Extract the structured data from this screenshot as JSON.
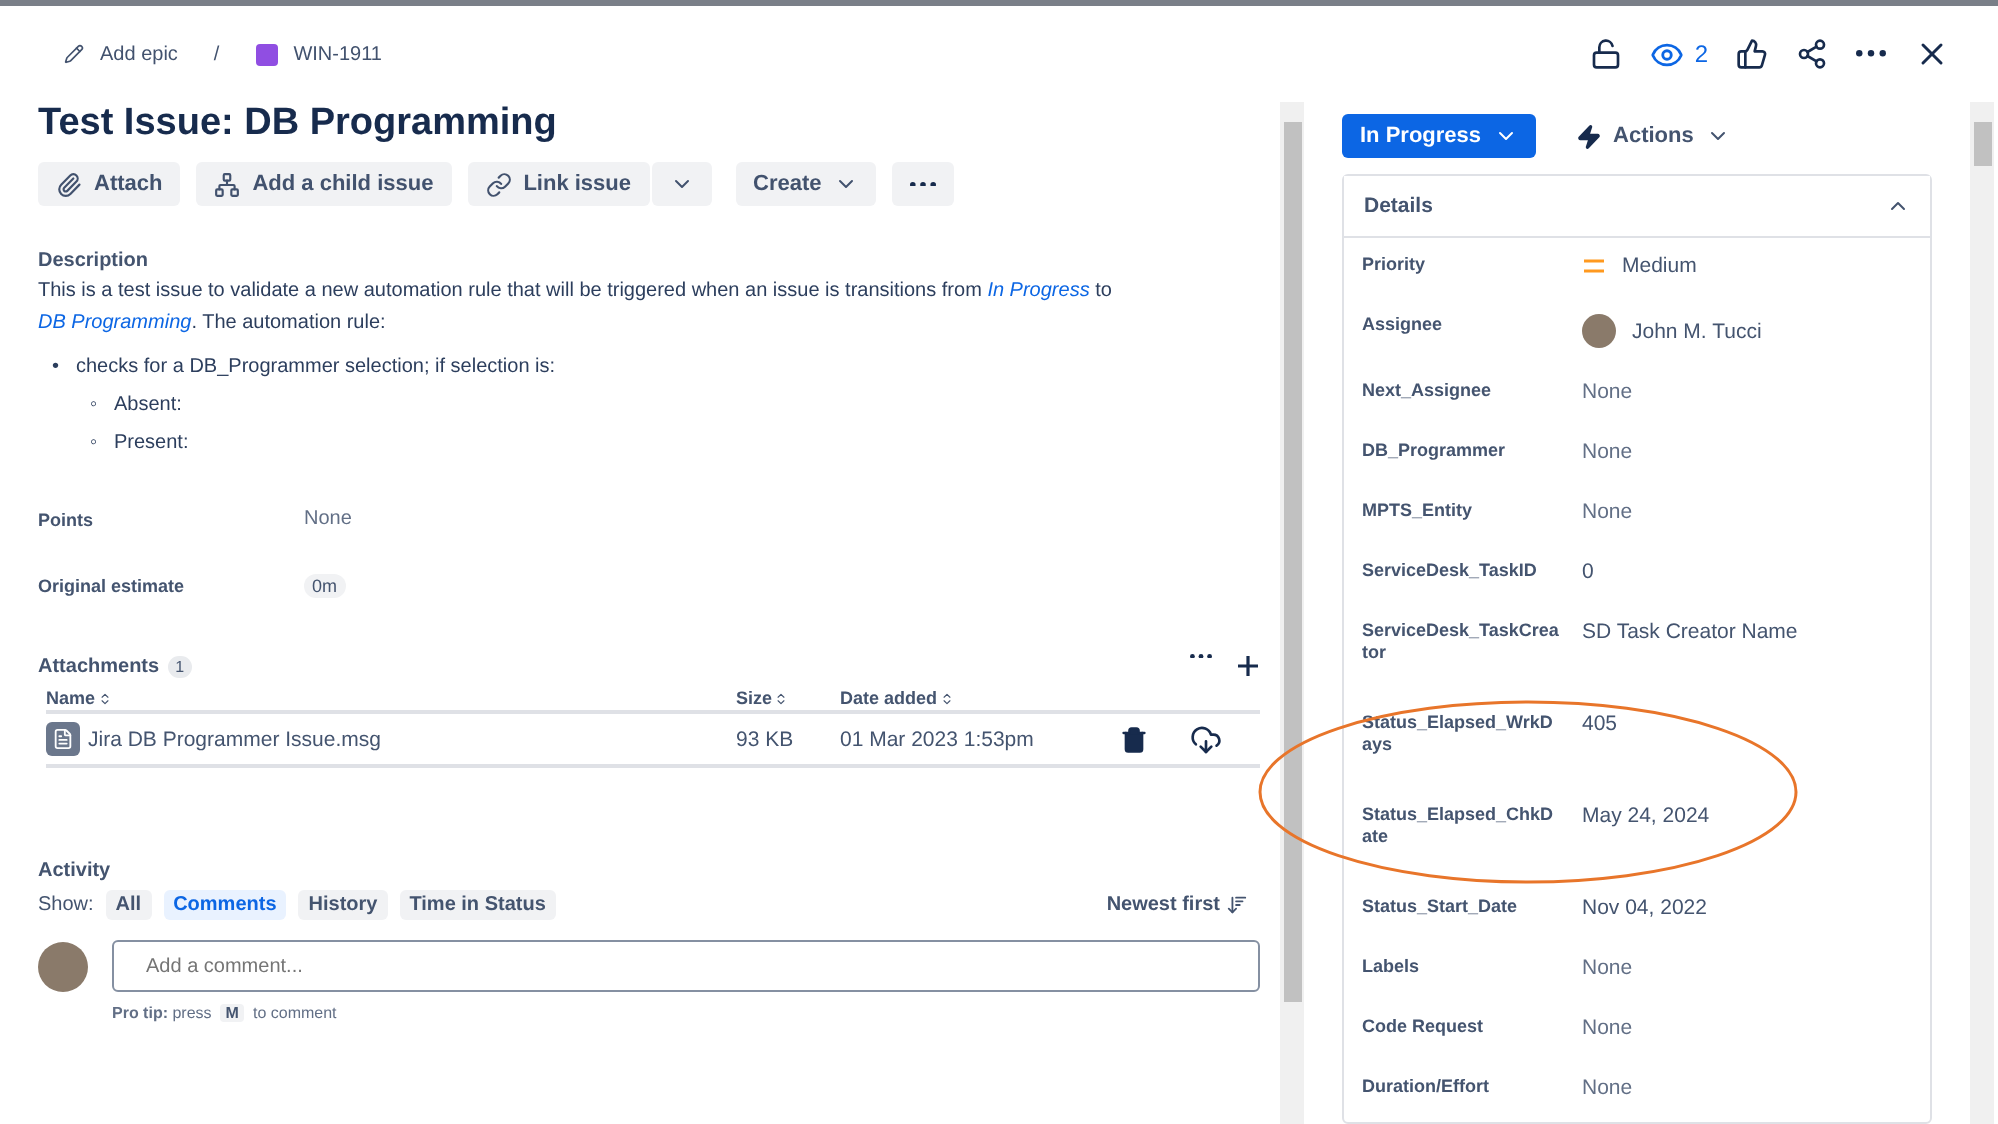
{
  "breadcrumb": {
    "epic": "Add epic",
    "separator": "/",
    "issue_key": "WIN-1911"
  },
  "header_actions": {
    "watchers": "2"
  },
  "title": "Test Issue: DB Programming",
  "toolbar": [
    {
      "kind": "attach",
      "label": "Attach"
    },
    {
      "kind": "child",
      "label": "Add a child issue"
    },
    {
      "kind": "link",
      "label": "Link issue"
    },
    {
      "kind": "create",
      "label": "Create"
    },
    {
      "kind": "more"
    }
  ],
  "description": {
    "heading": "Description",
    "text_before": "This is a test issue to validate a new automation rule that will be triggered when an issue is transitions from",
    "link_1": "In Progress",
    "text_middle": "to",
    "link_2": "DB Programming",
    "text_after": ". The automation rule:",
    "bullets": [
      {
        "marker": "•",
        "text": "checks for a DB_Programmer selection; if selection is:",
        "children": [
          {
            "marker": "◦",
            "text": "Absent:"
          },
          {
            "marker": "◦",
            "text": "Present:"
          }
        ]
      }
    ]
  },
  "fields": [
    {
      "label": "Points",
      "value": "None",
      "kind": "text"
    },
    {
      "label": "Original estimate",
      "value": "0m",
      "kind": "lozenge"
    }
  ],
  "attachments": {
    "heading": "Attachments",
    "count": "1",
    "columns": [
      "Name",
      "Size",
      "Date added"
    ],
    "rows": [
      {
        "name": "Jira DB Programmer Issue.msg",
        "size": "93 KB",
        "date": "01 Mar 2023 1:53pm"
      }
    ]
  },
  "activity": {
    "heading": "Activity",
    "show_label": "Show:",
    "tabs": [
      {
        "label": "All",
        "selected": false
      },
      {
        "label": "Comments",
        "selected": true
      },
      {
        "label": "History",
        "selected": false
      },
      {
        "label": "Time in Status",
        "selected": false
      }
    ],
    "sort": "Newest first",
    "comment_placeholder": "Add a comment...",
    "pro_tip": {
      "label": "Pro tip:",
      "before": "press",
      "key": "M",
      "after": "to comment"
    }
  },
  "status": {
    "label": "In Progress"
  },
  "actions": {
    "label": "Actions"
  },
  "details": {
    "heading": "Details",
    "expanded": true,
    "rows": [
      {
        "label": "Priority",
        "value": "Medium",
        "kind": "priority"
      },
      {
        "label": "Assignee",
        "value": "John M. Tucci",
        "kind": "user"
      },
      {
        "label": "Next_Assignee",
        "value": "None",
        "kind": "empty"
      },
      {
        "label": "DB_Programmer",
        "value": "None",
        "kind": "empty"
      },
      {
        "label": "MPTS_Entity",
        "value": "None",
        "kind": "empty"
      },
      {
        "label": "ServiceDesk_TaskID",
        "value": "0",
        "kind": "text"
      },
      {
        "label": "ServiceDesk_TaskCreator",
        "value": "SD Task Creator Name",
        "kind": "text"
      },
      {
        "label": "Status_Elapsed_WrkDays",
        "value": "405",
        "kind": "text"
      },
      {
        "label": "Status_Elapsed_ChkDate",
        "value": "May 24, 2024",
        "kind": "text"
      },
      {
        "label": "Status_Start_Date",
        "value": "Nov 04, 2022",
        "kind": "text"
      },
      {
        "label": "Labels",
        "value": "None",
        "kind": "empty"
      },
      {
        "label": "Code Request",
        "value": "None",
        "kind": "empty"
      },
      {
        "label": "Duration/Effort",
        "value": "None",
        "kind": "empty"
      }
    ]
  }
}
